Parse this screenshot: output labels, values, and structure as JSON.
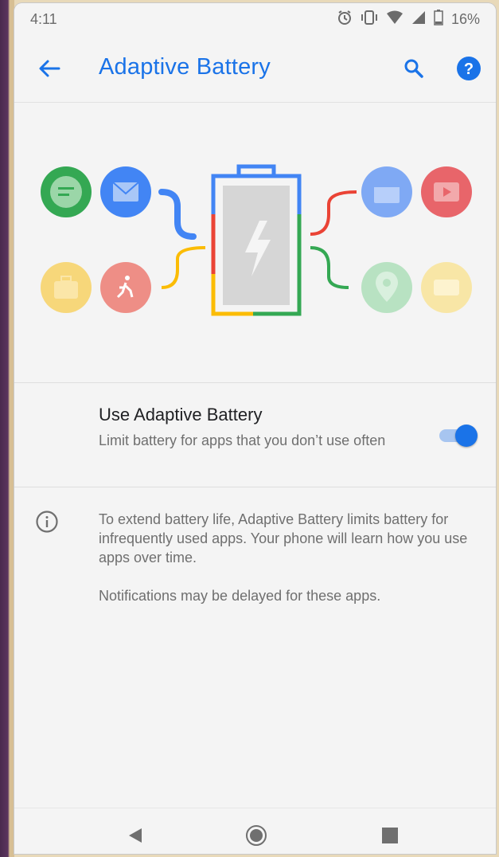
{
  "status": {
    "time": "4:11",
    "battery": "16%",
    "icons": [
      "alarm-icon",
      "vibrate-icon",
      "wifi-icon",
      "signal-icon",
      "battery-icon"
    ]
  },
  "appbar": {
    "title": "Adaptive Battery",
    "back_icon": "arrow-left-icon",
    "search_icon": "search-icon",
    "help_icon": "help-icon"
  },
  "setting": {
    "title": "Use Adaptive Battery",
    "subtitle": "Limit battery for apps that you don’t use often",
    "enabled": true
  },
  "info": {
    "icon": "info-icon",
    "paragraph1": "To extend battery life, Adaptive Battery limits battery for infrequently used apps. Your phone will learn how you use apps over time.",
    "paragraph2": "Notifications may be delayed for these apps."
  },
  "navbar": {
    "back_icon": "nav-back-icon",
    "home_icon": "nav-home-icon",
    "recents_icon": "nav-recents-icon"
  },
  "colors": {
    "accent": "#1a73e8",
    "green": "#34a853",
    "blue": "#4285f4",
    "yellow": "#fbbc05",
    "red": "#ea4335"
  }
}
